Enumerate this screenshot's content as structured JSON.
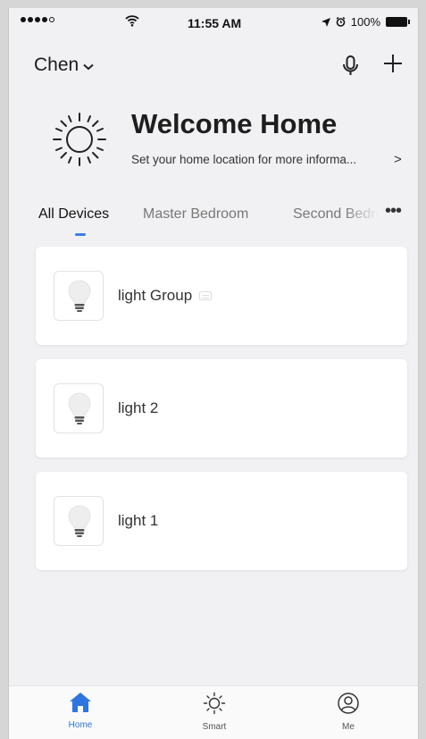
{
  "status_bar": {
    "time": "11:55 AM",
    "battery": "100%"
  },
  "header": {
    "home_name": "Chen",
    "mic_icon": "microphone-icon",
    "add_icon": "plus-icon"
  },
  "welcome": {
    "title": "Welcome Home",
    "subtitle": "Set your home location for more informa...",
    "arrow": ">"
  },
  "tabs": {
    "items": [
      {
        "label": "All Devices",
        "active": true
      },
      {
        "label": "Master Bedroom",
        "active": false
      },
      {
        "label": "Second Bedroom",
        "active": false
      }
    ],
    "more": "•••"
  },
  "devices": [
    {
      "name": "light Group",
      "icon": "light-bulb-icon",
      "is_group": true
    },
    {
      "name": "light 2",
      "icon": "light-bulb-icon",
      "is_group": false
    },
    {
      "name": "light 1",
      "icon": "light-bulb-icon",
      "is_group": false
    }
  ],
  "tabbar": {
    "items": [
      {
        "label": "Home",
        "icon": "home-icon",
        "active": true
      },
      {
        "label": "Smart",
        "icon": "sun-icon",
        "active": false
      },
      {
        "label": "Me",
        "icon": "user-icon",
        "active": false
      }
    ]
  },
  "colors": {
    "accent": "#3a7ee8",
    "tab_home_active": "#2f74e0",
    "background": "#f1f1f3",
    "card": "#ffffff"
  }
}
